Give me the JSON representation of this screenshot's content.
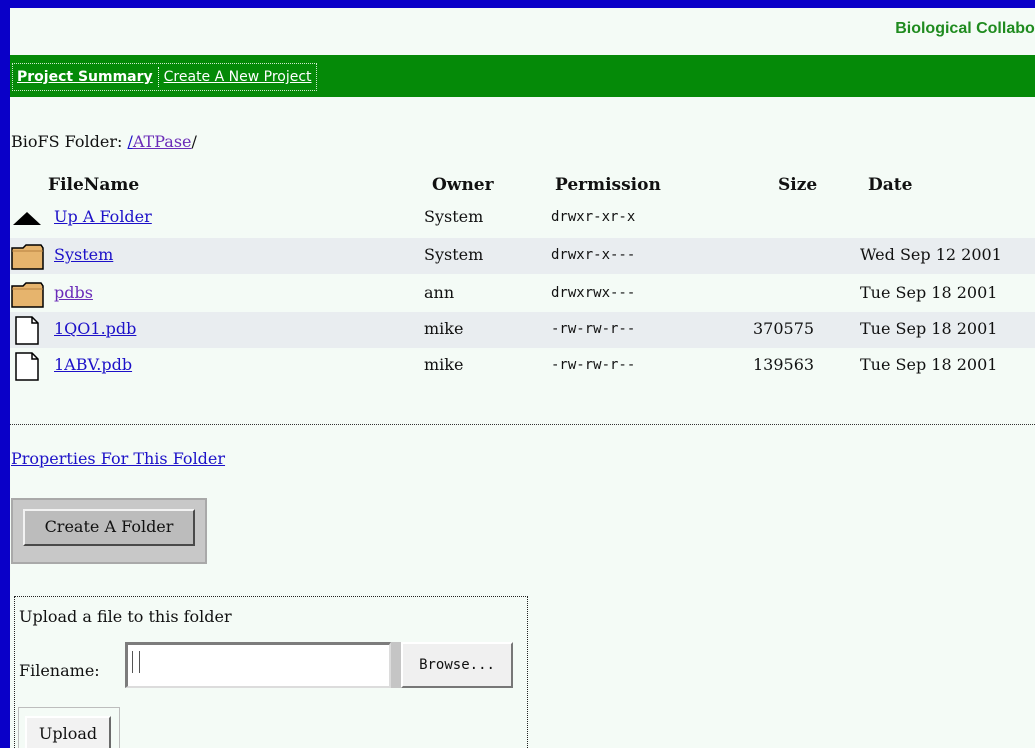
{
  "header": {
    "brand": "Biological Collabor"
  },
  "nav": {
    "items": [
      "Project Summary",
      "Create A New Project"
    ]
  },
  "path": {
    "label": "BioFS Folder:",
    "root": "/",
    "folder": "ATPase",
    "trail": "/"
  },
  "table": {
    "headers": [
      "FileName",
      "Owner",
      "Permission",
      "Size",
      "Date"
    ],
    "rows": [
      {
        "icon": "up-arrow-icon",
        "name": "Up A Folder",
        "owner": "System",
        "perm": "drwxr-xr-x",
        "size": "",
        "date": ""
      },
      {
        "icon": "folder-icon",
        "name": "System",
        "owner": "System",
        "perm": "drwxr-x---",
        "size": "",
        "date": "Wed Sep 12 2001"
      },
      {
        "icon": "folder-icon",
        "name": "pdbs",
        "owner": "ann",
        "perm": "drwxrwx---",
        "size": "",
        "date": "Tue Sep 18 2001"
      },
      {
        "icon": "file-icon",
        "name": "1QO1.pdb",
        "owner": "mike",
        "perm": "-rw-rw-r--",
        "size": "370575",
        "date": "Tue Sep 18 2001"
      },
      {
        "icon": "file-icon",
        "name": "1ABV.pdb",
        "owner": "mike",
        "perm": "-rw-rw-r--",
        "size": "139563",
        "date": "Tue Sep 18 2001"
      }
    ]
  },
  "actions": {
    "properties_link": "Properties For This Folder",
    "create_folder": "Create A Folder"
  },
  "upload": {
    "title": "Upload a file to this folder",
    "filename_label": "Filename:",
    "filename_value": "",
    "browse": "Browse...",
    "submit": "Upload"
  },
  "colors": {
    "frame": "#0a00c8",
    "nav_bg": "#058a08",
    "brand": "#1f8b1f",
    "link": "#1c10c8",
    "visited": "#6a2bb8"
  }
}
